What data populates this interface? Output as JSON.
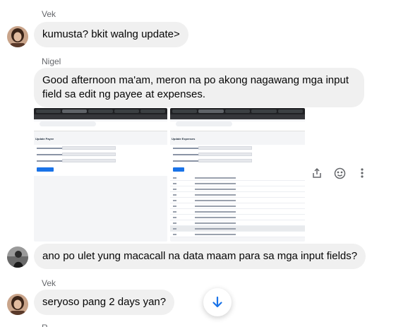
{
  "colors": {
    "bubble": "#f0f0f0",
    "meta": "#65676b",
    "accent": "#1a73e8"
  },
  "messages": [
    {
      "sender": "Vek",
      "text": "kumusta? bkit walng update>"
    },
    {
      "sender": "Nigel",
      "text": "Good afternoon ma'am, meron na po akong nagawang mga input field sa edit ng payee at expenses."
    },
    {
      "text": "ano po ulet yung macacall na data maam para sa mga input fields?"
    },
    {
      "sender": "Vek",
      "text": "seryoso pang 2 days yan?"
    },
    {
      "sender": "R"
    }
  ],
  "attachments": [
    {
      "page_title": "Update Payee",
      "button": "UPDATE PAYEE"
    },
    {
      "page_title": "Update Expenses",
      "button": "UPDATE"
    }
  ],
  "icons": {
    "share": "share-icon",
    "react": "smiley-icon",
    "more": "more-vertical-icon",
    "scroll": "arrow-down-icon"
  }
}
